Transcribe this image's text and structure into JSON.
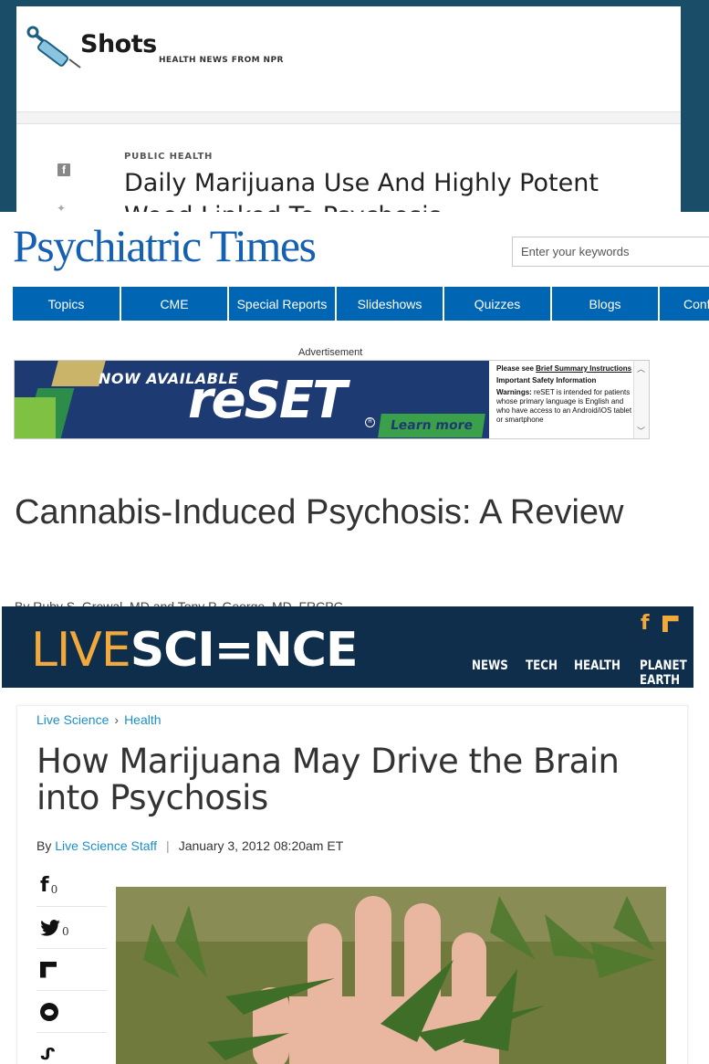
{
  "npr": {
    "brand": "Shots",
    "tagline": "HEALTH NEWS FROM NPR",
    "kicker": "PUBLIC HEALTH",
    "headline": "Daily Marijuana Use And Highly Potent",
    "headline_cut": "Weed Linked To Psychosis"
  },
  "psychtimes": {
    "brand": "Psychiatric Times",
    "search_placeholder": "Enter your keywords",
    "nav": [
      "Topics",
      "CME",
      "Special Reports",
      "Slideshows",
      "Quizzes",
      "Blogs",
      "Conf"
    ],
    "ad_label": "Advertisement",
    "ad": {
      "now_available": "NOW AVAILABLE",
      "product": "reSET",
      "cta": "Learn more",
      "info_line1_prefix": "Please see ",
      "info_link": "Brief Summary Instructions",
      "info_heading": "Important Safety Information",
      "warnings_label": "Warnings:",
      "warnings_text": " reSET is intended for patients whose primary language is English and who have access to an Android/iOS tablet or smartphone"
    },
    "title": "Cannabis-Induced Psychosis: A Review",
    "byline": "By Ruby S. Grewal, MD and  Tony P. George, MD, FRCPC"
  },
  "livescience": {
    "logo_live": "LIVE",
    "logo_science": "SCI=NCE",
    "nav": [
      "NEWS",
      "TECH",
      "HEALTH",
      "PLANET EARTH"
    ],
    "breadcrumb": [
      "Live Science",
      "Health"
    ],
    "title": "How Marijuana May Drive the Brain into Psychosis",
    "byline_prefix": "By ",
    "author": "Live Science Staff",
    "date": "January 3, 2012 08:20am ET",
    "share": {
      "facebook_count": "0",
      "twitter_count": "0"
    },
    "colors": {
      "header_bg": "#0f2e4c",
      "accent": "#f2a93b",
      "link": "#1a8fc9"
    }
  }
}
